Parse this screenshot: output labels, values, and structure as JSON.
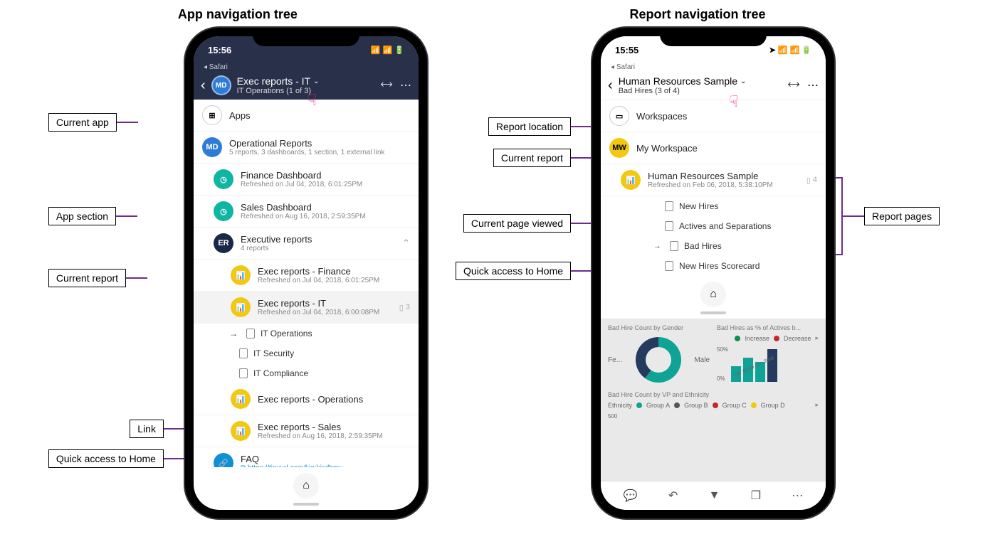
{
  "titles": {
    "left": "App navigation tree",
    "right": "Report navigation tree"
  },
  "labels": {
    "current_app": "Current app",
    "app_section": "App section",
    "current_report": "Current report",
    "link": "Link",
    "quick_home": "Quick access to Home",
    "report_location": "Report location",
    "curr_report2": "Current report",
    "curr_page": "Current page viewed",
    "report_pages": "Report pages"
  },
  "left_phone": {
    "status_time": "15:56",
    "safari": "◂ Safari",
    "header_avatar": "MD",
    "header_title": "Exec reports - IT",
    "header_sub": "IT Operations (1 of 3)",
    "apps_label": "Apps",
    "app": {
      "avatar": "MD",
      "title": "Operational Reports",
      "sub": "5 reports, 3 dashboards, 1 section, 1 external link"
    },
    "dashboards": [
      {
        "title": "Finance Dashboard",
        "sub": "Refreshed on Jul 04, 2018, 6:01:25PM"
      },
      {
        "title": "Sales Dashboard",
        "sub": "Refreshed on Aug 16, 2018, 2:59:35PM"
      }
    ],
    "section": {
      "avatar": "ER",
      "title": "Executive reports",
      "sub": "4 reports"
    },
    "reports": [
      {
        "title": "Exec reports - Finance",
        "sub": "Refreshed on Jul 04, 2018, 6:01:25PM"
      },
      {
        "title": "Exec reports - IT",
        "sub": "Refreshed on Jul 04, 2018, 6:00:08PM",
        "meta": "3",
        "current": true
      },
      {
        "title": "Exec reports - Operations",
        "sub": ""
      },
      {
        "title": "Exec reports - Sales",
        "sub": "Refreshed on Aug 16, 2018, 2:59:35PM"
      }
    ],
    "pages": [
      "IT Operations",
      "IT Security",
      "IT Compliance"
    ],
    "faq": {
      "title": "FAQ",
      "url": "https://tinyurl.com/kjg;kjsdbmv"
    }
  },
  "right_phone": {
    "status_time": "15:55",
    "safari": "◂ Safari",
    "header_title": "Human Resources Sample",
    "header_sub": "Bad Hires (3 of 4)",
    "workspaces_label": "Workspaces",
    "workspace": {
      "avatar": "MW",
      "title": "My Workspace"
    },
    "report": {
      "title": "Human Resources Sample",
      "sub": "Refreshed on Feb 06, 2018, 5:38:10PM",
      "meta": "4"
    },
    "pages": [
      "New Hires",
      "Actives and Separations",
      "Bad Hires",
      "New Hires Scorecard"
    ],
    "preview": {
      "t1": "Bad Hire Count by Gender",
      "t2": "Bad Hires as % of Actives b...",
      "leg_inc": "Increase",
      "leg_dec": "Decrease",
      "fe": "Fe...",
      "male": "Male",
      "pct50": "50%",
      "pct0": "0%",
      "x1": "<30",
      "x2": "30-49",
      "x3": "50+",
      "x4": "Total",
      "t3": "Bad Hire Count by VP and Ethnicity",
      "eth": "Ethnicity",
      "gA": "Group A",
      "gB": "Group B",
      "gC": "Group C",
      "gD": "Group D",
      "y500": "500"
    }
  }
}
